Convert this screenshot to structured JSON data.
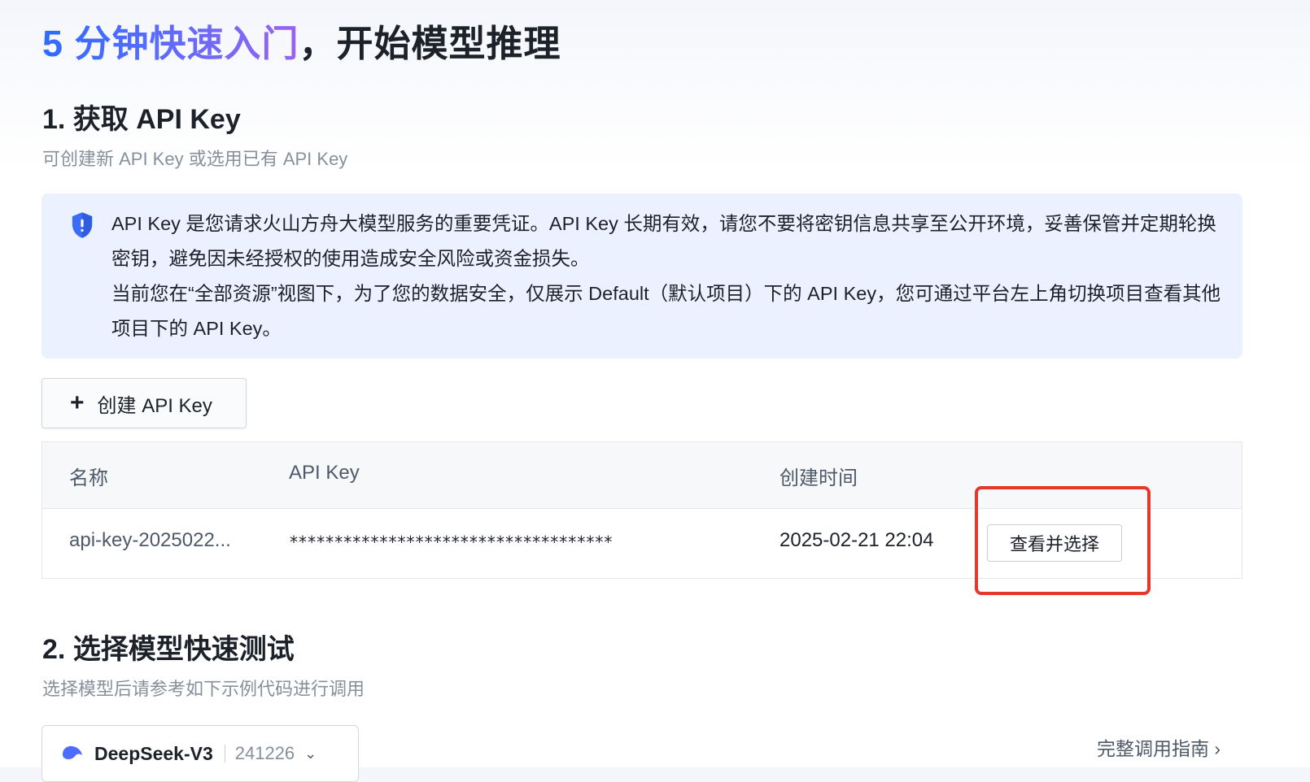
{
  "page": {
    "title_highlight": "5 分钟快速入门",
    "title_rest": "，开始模型推理"
  },
  "section1": {
    "title": "1. 获取 API Key",
    "subtitle": "可创建新 API Key 或选用已有 API Key",
    "notice": {
      "icon": "shield-icon",
      "line1": "API Key 是您请求火山方舟大模型服务的重要凭证。API Key 长期有效，请您不要将密钥信息共享至公开环境，妥善保管并定期轮换密钥，避免因未经授权的使用造成安全风险或资金损失。",
      "line2": "当前您在“全部资源”视图下，为了您的数据安全，仅展示 Default（默认项目）下的 API Key，您可通过平台左上角切换项目查看其他项目下的 API Key。"
    },
    "create_button": {
      "icon": "plus-icon",
      "label": "创建 API Key"
    },
    "table": {
      "columns": [
        "名称",
        "API Key",
        "创建时间"
      ],
      "rows": [
        {
          "name": "api-key-2025022...",
          "key": "************************************",
          "created": "2025-02-21 22:04",
          "action": "查看并选择"
        }
      ]
    }
  },
  "section2": {
    "title": "2. 选择模型快速测试",
    "subtitle": "选择模型后请参考如下示例代码进行调用",
    "model_select": {
      "name": "DeepSeek-V3",
      "version": "241226"
    },
    "guide_link": "完整调用指南 ›"
  },
  "colors": {
    "accent_start": "#2f6bff",
    "accent_end": "#9a63f2",
    "notice_bg": "#ebf1ff",
    "highlight_border": "#e5382d"
  }
}
